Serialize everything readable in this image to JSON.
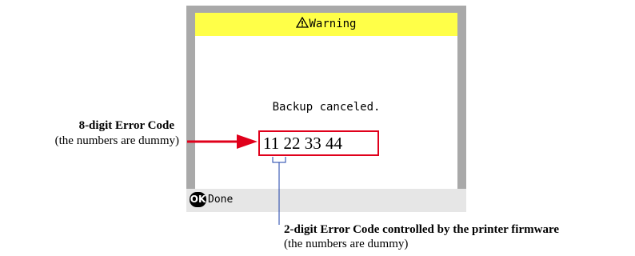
{
  "screen": {
    "title": "Warning",
    "title_icon": "warning-triangle-icon",
    "message": "Backup canceled.",
    "error_code": "11 22 33 44",
    "footer": {
      "ok_label": "OK",
      "done_label": "Done"
    }
  },
  "annotations": {
    "eight_digit": {
      "title": "8-digit Error Code",
      "subtitle": "(the numbers are dummy)"
    },
    "two_digit": {
      "title": "2-digit Error Code controlled by the printer firmware",
      "subtitle": "(the numbers are dummy)"
    }
  },
  "colors": {
    "title_bar": "#ffff48",
    "highlight": "#e0001b",
    "bracket_line": "#1a3fa8",
    "frame": "#a9a9a9",
    "footer": "#e6e6e6"
  }
}
